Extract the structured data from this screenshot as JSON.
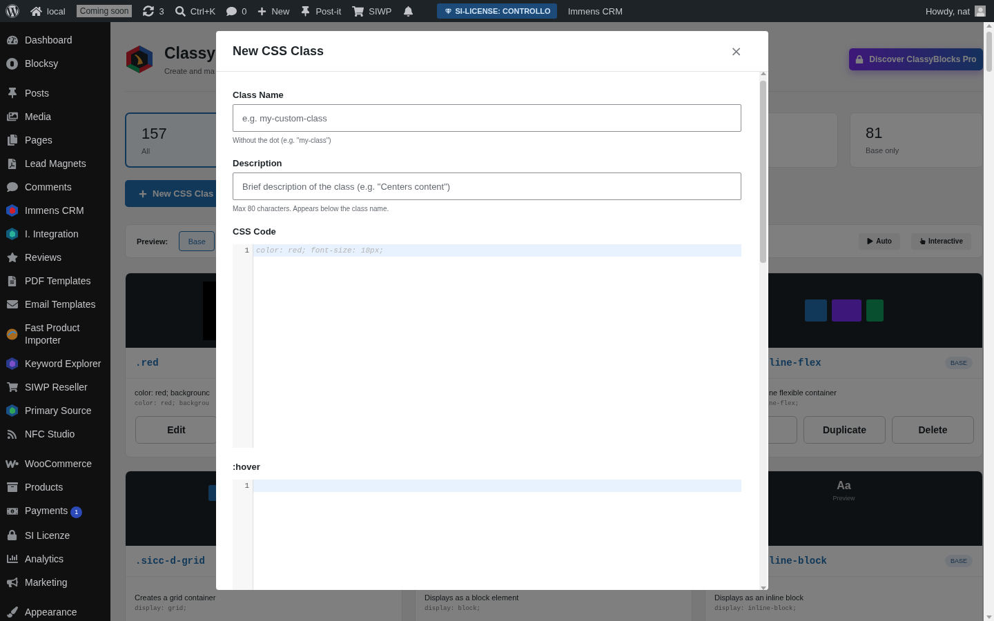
{
  "admin_bar": {
    "site": "local",
    "status_badge": "Coming soon",
    "updates": "3",
    "search": "Ctrl+K",
    "comments": "0",
    "new_item": "New",
    "postit": "Post-it",
    "shop": "SIWP",
    "license": "SI-LICENSE: CONTROLLO",
    "crm": "Immens CRM",
    "greeting": "Howdy, nat"
  },
  "sidebar": {
    "groups": [
      [
        {
          "label": "Dashboard"
        },
        {
          "label": "Blocksy"
        }
      ],
      [
        {
          "label": "Posts"
        },
        {
          "label": "Media"
        },
        {
          "label": "Pages"
        },
        {
          "label": "Lead Magnets"
        },
        {
          "label": "Comments"
        },
        {
          "label": "Immens CRM"
        },
        {
          "label": "I. Integration"
        },
        {
          "label": "Reviews"
        },
        {
          "label": "PDF Templates"
        },
        {
          "label": "Email Templates"
        },
        {
          "label": "Fast Product Importer"
        },
        {
          "label": "Keyword Explorer"
        },
        {
          "label": "SIWP Reseller"
        },
        {
          "label": "Primary Source"
        },
        {
          "label": "NFC Studio"
        }
      ],
      [
        {
          "label": "WooCommerce"
        },
        {
          "label": "Products"
        },
        {
          "label": "Payments",
          "badge": "1"
        },
        {
          "label": "SI Licenze"
        },
        {
          "label": "Analytics"
        },
        {
          "label": "Marketing"
        }
      ],
      [
        {
          "label": "Appearance"
        }
      ]
    ]
  },
  "header": {
    "title": "Classy",
    "subtitle": "Create and ma",
    "pro_button": "Discover ClassyBlocks Pro"
  },
  "stats": {
    "left": {
      "count": "157",
      "label": "All",
      "selected": true
    },
    "right": {
      "count": "81",
      "label": "Base only",
      "selected": false
    }
  },
  "new_button": "New CSS Clas",
  "preview_bar": {
    "label": "Preview:",
    "modes": [
      {
        "label": "Base",
        "selected": true
      }
    ],
    "actions": [
      "Auto",
      "Interactive"
    ]
  },
  "card_rows": [
    {
      "left": {
        "preview": {
          "kind": "box"
        },
        "name": ".red",
        "description": "color: red; backgrounc",
        "code": "color: red; backgrou",
        "buttons": [
          "Edit"
        ]
      },
      "right": {
        "preview": {
          "kind": "swatches"
        },
        "name": "line-flex",
        "badge": "BASE",
        "description": "ne flexible container",
        "code": "ne-flex;",
        "buttons": [
          "Duplicate",
          "Delete"
        ]
      }
    },
    {
      "left": {
        "preview": {
          "kind": "grid"
        },
        "name": ".sicc-d-grid",
        "description": "Creates a grid container",
        "code": "display: grid;"
      },
      "middle": {
        "description": "Displays as a block element",
        "code": "display: block;"
      },
      "right": {
        "preview": {
          "kind": "text",
          "glyph": "Aa",
          "caption": "Preview"
        },
        "name": "line-block",
        "badge": "BASE",
        "description": "Displays as an inline block",
        "code": "display: inline-block;"
      }
    }
  ],
  "modal": {
    "title": "New CSS Class",
    "close": "×",
    "fields": [
      {
        "label": "Class Name",
        "placeholder": "e.g. my-custom-class",
        "hint": "Without the dot (e.g. \"my-class\")"
      },
      {
        "label": "Description",
        "placeholder": "Brief description of the class (e.g. \"Centers content\")",
        "hint": "Max 80 characters. Appears below the class name."
      }
    ],
    "editors": [
      {
        "label": "CSS Code",
        "line": "1",
        "placeholder": "color: red; font-size: 18px;"
      },
      {
        "label": ":hover",
        "line": "1"
      }
    ]
  }
}
